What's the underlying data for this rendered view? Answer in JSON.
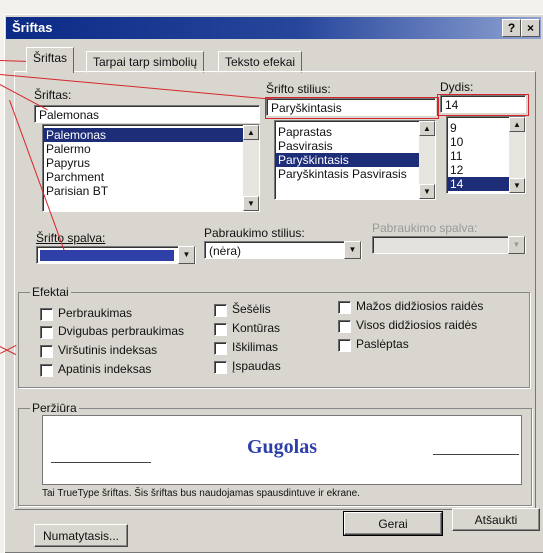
{
  "dialog": {
    "title": "Šriftas",
    "help_button": "?",
    "close_button": "×"
  },
  "tabs": [
    {
      "label": "Šriftas",
      "active": true
    },
    {
      "label": "Tarpai tarp simbolių",
      "active": false
    },
    {
      "label": "Teksto efekai",
      "active": false
    }
  ],
  "font": {
    "label": "Šriftas:",
    "value": "Palemonas",
    "options": [
      "Palemonas",
      "Palermo",
      "Papyrus",
      "Parchment",
      "Parisian BT"
    ],
    "selected": "Palemonas"
  },
  "style": {
    "label": "Šrifto stilius:",
    "value": "Paryškintasis",
    "options": [
      "Paprastas",
      "Pasvirasis",
      "Paryškintasis",
      "Paryškintasis Pasvirasis"
    ],
    "selected": "Paryškintasis"
  },
  "size": {
    "label": "Dydis:",
    "value": "14",
    "options": [
      "9",
      "10",
      "11",
      "12",
      "14"
    ],
    "selected": "14"
  },
  "font_color": {
    "label": "Šrifto spalva:",
    "color": "#2f3fa8"
  },
  "underline_style": {
    "label": "Pabraukimo stilius:",
    "value": "(nėra)"
  },
  "underline_color": {
    "label": "Pabraukimo spalva:",
    "value": ""
  },
  "effects": {
    "label": "Efektai",
    "col1": [
      "Perbraukimas",
      "Dvigubas perbraukimas",
      "Viršutinis indeksas",
      "Apatinis indeksas"
    ],
    "col2": [
      "Šešėlis",
      "Kontūras",
      "Iškilimas",
      "Įspaudas"
    ],
    "col3": [
      "Mažos didžiosios raidės",
      "Visos didžiosios raidės",
      "Paslėptas"
    ]
  },
  "preview": {
    "label": "Peržiūra",
    "sample": "Gugolas",
    "info": "Tai TrueType šriftas. Šis šriftas bus naudojamas spausdintuve ir ekrane."
  },
  "buttons": {
    "default": "Numatytasis...",
    "ok": "Gerai",
    "cancel": "Atšaukti"
  },
  "colors": {
    "selection": "#1e2d78",
    "preview_text": "#2f3fa8",
    "annotation": "#d7262b"
  }
}
